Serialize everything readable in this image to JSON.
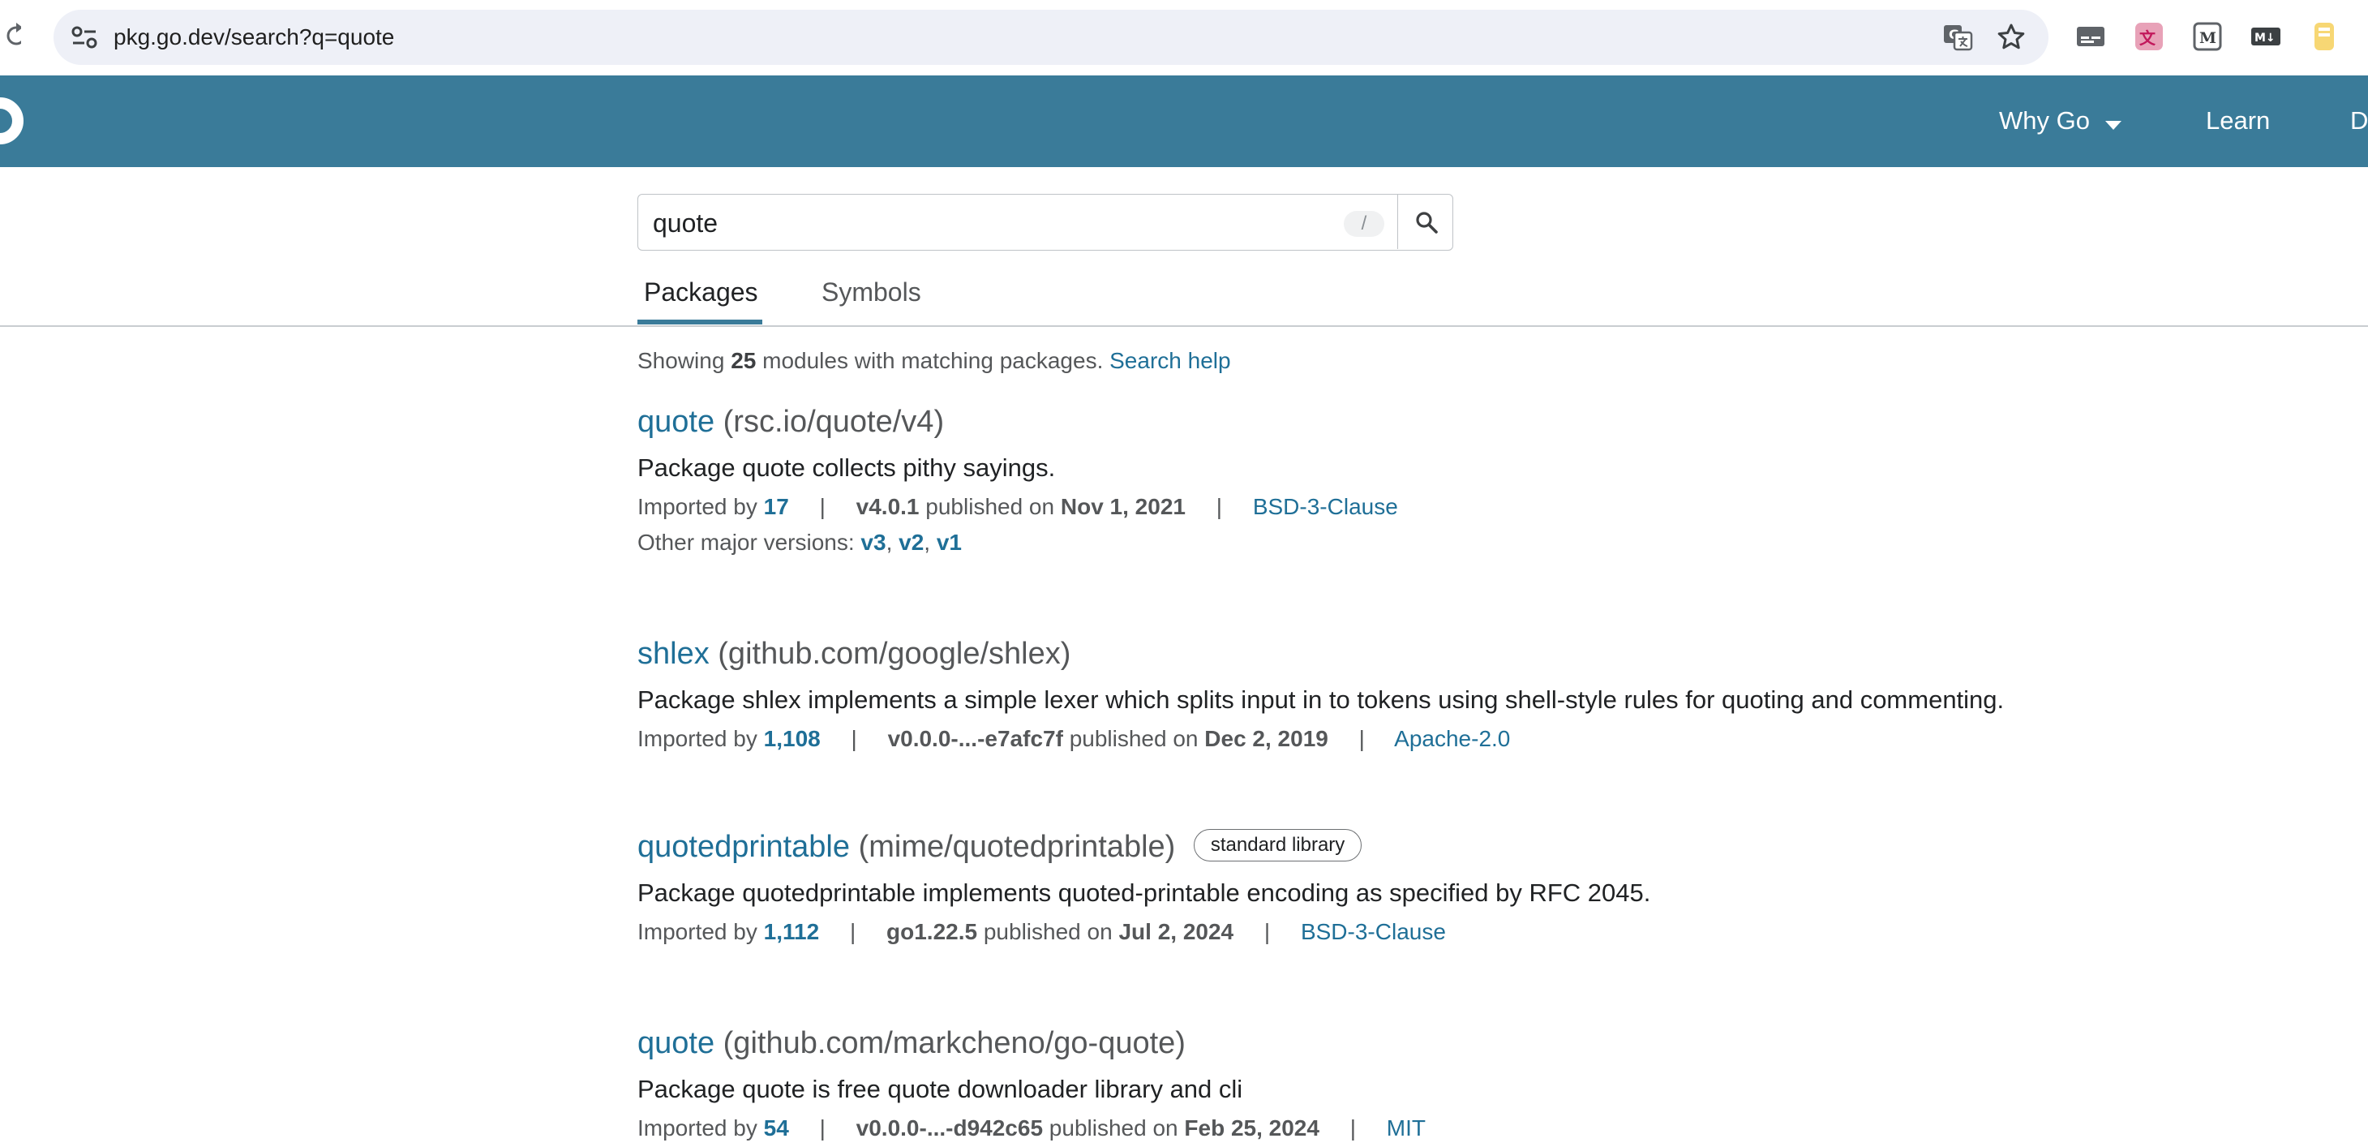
{
  "browser": {
    "url": "pkg.go.dev/search?q=quote"
  },
  "nav": {
    "why_go": "Why Go",
    "learn": "Learn",
    "docs": "D"
  },
  "search": {
    "value": "quote",
    "shortcut": "/"
  },
  "tabs": {
    "packages": "Packages",
    "symbols": "Symbols"
  },
  "summary": {
    "prefix": "Showing",
    "count": "25",
    "suffix": "modules with matching packages.",
    "help": "Search help"
  },
  "labels": {
    "imported_by": "Imported by",
    "published_on": "published on",
    "other_versions": "Other major versions:",
    "comma": ","
  },
  "results": [
    {
      "name": "quote",
      "path": "(rsc.io/quote/v4)",
      "synopsis": "Package quote collects pithy sayings.",
      "imported_by": "17",
      "version": "v4.0.1",
      "date": "Nov 1, 2021",
      "license": "BSD-3-Clause",
      "other_versions": [
        "v3",
        "v2",
        "v1"
      ]
    },
    {
      "name": "shlex",
      "path": "(github.com/google/shlex)",
      "synopsis": "Package shlex implements a simple lexer which splits input in to tokens using shell-style rules for quoting and commenting.",
      "imported_by": "1,108",
      "version": "v0.0.0-...-e7afc7f",
      "date": "Dec 2, 2019",
      "license": "Apache-2.0"
    },
    {
      "name": "quotedprintable",
      "path": "(mime/quotedprintable)",
      "badge": "standard library",
      "synopsis": "Package quotedprintable implements quoted-printable encoding as specified by RFC 2045.",
      "imported_by": "1,112",
      "version": "go1.22.5",
      "date": "Jul 2, 2024",
      "license": "BSD-3-Clause"
    },
    {
      "name": "quote",
      "path": "(github.com/markcheno/go-quote)",
      "synopsis": "Package quote is free quote downloader library and cli",
      "imported_by": "54",
      "version": "v0.0.0-...-d942c65",
      "date": "Feb 25, 2024",
      "license": "MIT"
    }
  ],
  "icons": {
    "reload": "reload-icon",
    "site_info": "tune-icon",
    "translate": "translate-icon",
    "bookmark": "star-icon",
    "search": "search-icon"
  },
  "colors": {
    "header": "#3a7b99",
    "link": "#1f6f97"
  }
}
